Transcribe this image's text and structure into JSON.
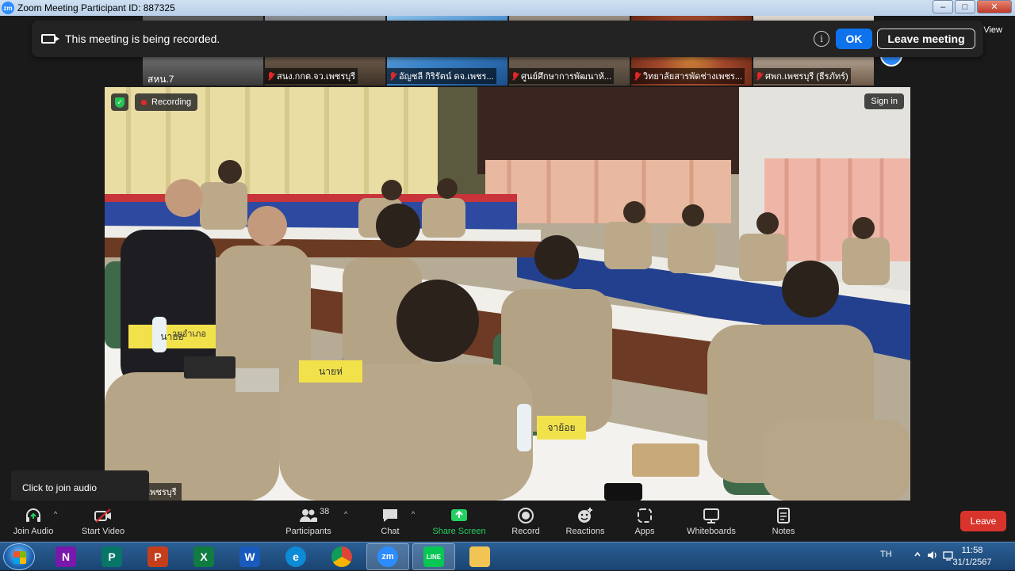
{
  "window": {
    "app_icon": "zm",
    "title": "Zoom Meeting Participant ID: 887325",
    "minimize": "–",
    "maximize": "□",
    "close": "✕"
  },
  "banner": {
    "message": "This meeting is being recorded.",
    "ok_label": "OK",
    "leave_label": "Leave meeting",
    "info_glyph": "i"
  },
  "view_label": "View",
  "thumbnails": {
    "first_name": "สหน.7",
    "items": [
      {
        "name": "สนง.กกต.จว.เพชรบุรี",
        "muted": true,
        "color": "#6b5a4a"
      },
      {
        "name": "อัญชลี กิริรัตน์ ดจ.เพชร...",
        "muted": true,
        "color": "#3a83c9"
      },
      {
        "name": "ศูนย์ศึกษาการพัฒนาห้...",
        "muted": true,
        "color": "#7a6a58"
      },
      {
        "name": "วิทยาลัยสารพัดช่างเพชร...",
        "muted": true,
        "color": "#a4492c"
      },
      {
        "name": "ศพก.เพชรบุรี (ธีรภัทร์)",
        "muted": true,
        "color": "#b8a998"
      }
    ]
  },
  "video": {
    "recording_label": "Recording",
    "sign_in_label": "Sign in",
    "shield_glyph": "✓",
    "participant_name": "จังหวัดเพชรบุรี",
    "placards": [
      "นายอ",
      "ายอำเภอ",
      "นายห่",
      "จาย้อย"
    ]
  },
  "tooltip": "Click to join audio",
  "toolbar": {
    "join_audio": "Join Audio",
    "start_video": "Start Video",
    "participants": "Participants",
    "participants_count": "38",
    "chat": "Chat",
    "share_screen": "Share Screen",
    "record": "Record",
    "reactions": "Reactions",
    "apps": "Apps",
    "whiteboards": "Whiteboards",
    "notes": "Notes",
    "leave": "Leave",
    "caret": "^"
  },
  "taskbar": {
    "apps": [
      {
        "name": "onenote",
        "letter": "N",
        "color": "#7719aa"
      },
      {
        "name": "publisher",
        "letter": "P",
        "color": "#077568"
      },
      {
        "name": "powerpoint",
        "letter": "P",
        "color": "#c43e1c"
      },
      {
        "name": "excel",
        "letter": "X",
        "color": "#107c41"
      },
      {
        "name": "word",
        "letter": "W",
        "color": "#185abd"
      },
      {
        "name": "edge",
        "letter": "e",
        "color": "#0c8bd6"
      },
      {
        "name": "chrome",
        "letter": "",
        "color": "#db4437"
      },
      {
        "name": "zoom",
        "letter": "zm",
        "color": "#2d8cff"
      },
      {
        "name": "line",
        "letter": "LINE",
        "color": "#06c755"
      },
      {
        "name": "explorer",
        "letter": "",
        "color": "#f1c453"
      }
    ],
    "language": "TH",
    "time": "11:58",
    "date": "31/1/2567"
  }
}
